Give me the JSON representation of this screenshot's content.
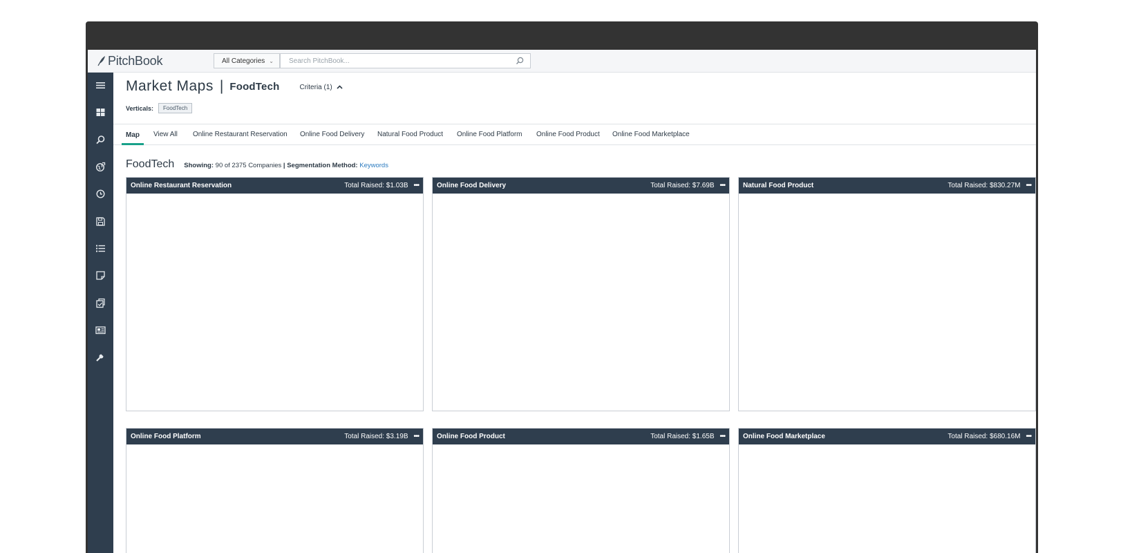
{
  "header": {
    "logo_text": "PitchBook",
    "category_select": "All Categories",
    "search_placeholder": "Search PitchBook..."
  },
  "sidebar": {
    "items": [
      "menu-icon",
      "dashboard-icon",
      "search-icon",
      "globe-icon",
      "history-icon",
      "save-icon",
      "list-icon",
      "note-icon",
      "clipboard-icon",
      "news-icon",
      "wrench-icon"
    ]
  },
  "page": {
    "title": "Market Maps",
    "separator": "|",
    "subtitle": "FoodTech",
    "criteria": "Criteria (1)",
    "verticals_label": "Verticals:",
    "vertical_tag": "FoodTech"
  },
  "tabs": [
    {
      "label": "Map",
      "active": true
    },
    {
      "label": "View All",
      "active": false
    },
    {
      "label": "Online Restaurant Reservation",
      "active": false
    },
    {
      "label": "Online Food Delivery",
      "active": false
    },
    {
      "label": "Natural Food Product",
      "active": false
    },
    {
      "label": "Online Food Platform",
      "active": false
    },
    {
      "label": "Online Food Product",
      "active": false
    },
    {
      "label": "Online Food Marketplace",
      "active": false
    }
  ],
  "section": {
    "title": "FoodTech",
    "showing_label": "Showing:",
    "showing_value": "90 of 2375 Companies",
    "divider": "|",
    "segmentation_label": "Segmentation Method:",
    "segmentation_value": "Keywords"
  },
  "panels": [
    {
      "name": "Online Restaurant Reservation",
      "total": "Total Raised: $1.03B"
    },
    {
      "name": "Online Food Delivery",
      "total": "Total Raised: $7.69B"
    },
    {
      "name": "Natural Food Product",
      "total": "Total Raised: $830.27M"
    },
    {
      "name": "Online Food Platform",
      "total": "Total Raised: $3.19B"
    },
    {
      "name": "Online Food Product",
      "total": "Total Raised: $1.65B"
    },
    {
      "name": "Online Food Marketplace",
      "total": "Total Raised: $680.16M"
    }
  ],
  "panel_more_label": "•••",
  "colors": {
    "frame": "#333333",
    "sidebar": "#2f3e4e",
    "panel_header": "#2f3e4e",
    "accent": "#18a18a",
    "link": "#2b7bc0"
  }
}
